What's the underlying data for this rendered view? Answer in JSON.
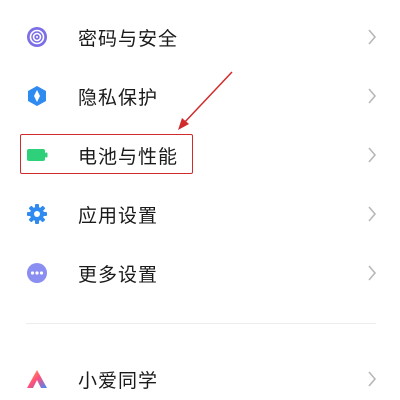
{
  "settings": {
    "items": [
      {
        "id": "password-security",
        "label": "密码与安全",
        "icon": "fingerprint-icon",
        "color": "#7b6ee6"
      },
      {
        "id": "privacy",
        "label": "隐私保护",
        "icon": "privacy-shield-icon",
        "color": "#2f8bf0"
      },
      {
        "id": "battery",
        "label": "电池与性能",
        "icon": "battery-icon",
        "color": "#2fd07a"
      },
      {
        "id": "app-settings",
        "label": "应用设置",
        "icon": "gear-icon",
        "color": "#2f8bf0"
      },
      {
        "id": "more-settings",
        "label": "更多设置",
        "icon": "more-dots-icon",
        "color": "#8a8ef0"
      },
      {
        "id": "xiaoai",
        "label": "小爱同学",
        "icon": "xiaoai-logo-icon",
        "color": "#ff4e7a"
      }
    ]
  },
  "annotation": {
    "highlight_color": "#d12b2b"
  }
}
